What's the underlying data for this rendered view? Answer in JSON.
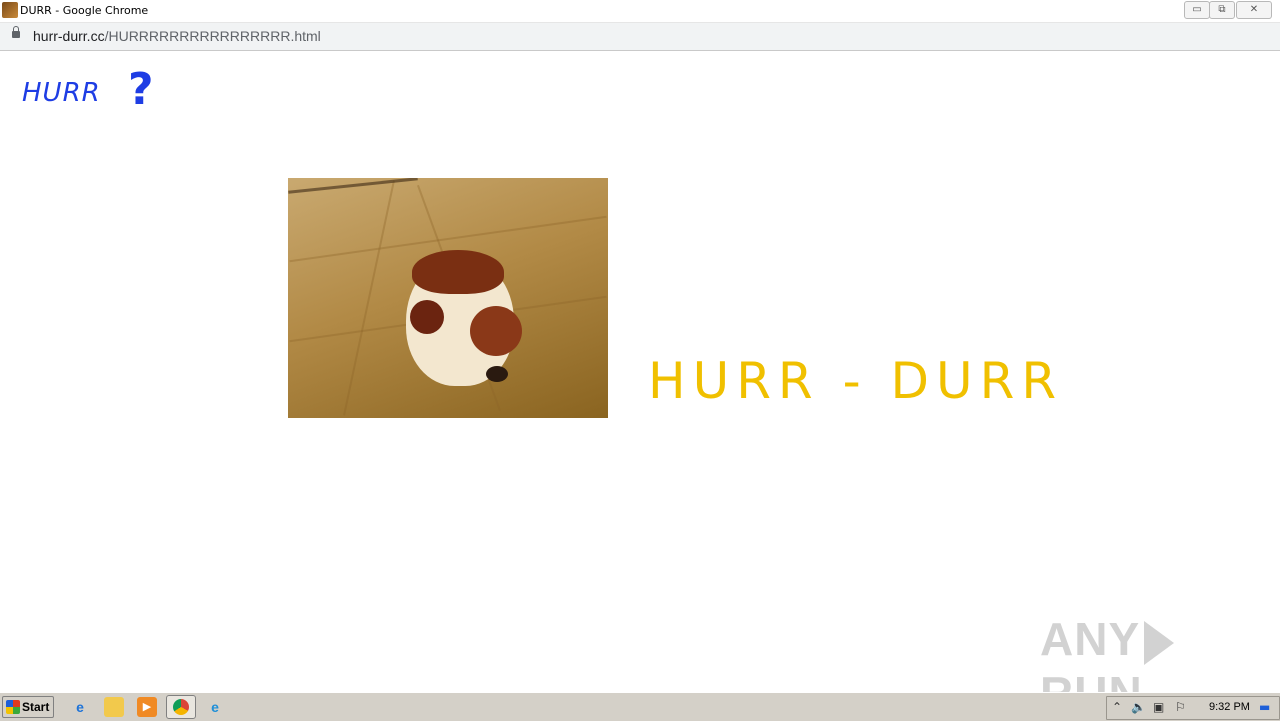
{
  "window": {
    "title": "DURR - Google Chrome",
    "controls": {
      "minimize": "▭",
      "restore": "⧉",
      "close": "✕"
    }
  },
  "address_bar": {
    "host": "hurr-durr.cc",
    "path": "/HURRRRRRRRRRRRRRRR.html"
  },
  "page": {
    "logo_text": "HURR",
    "logo_mark": "?",
    "headline": "HURR - DURR",
    "colors": {
      "logo": "#1e3de4",
      "headline": "#f0c000"
    }
  },
  "watermark": {
    "left": "ANY",
    "right": "RUN"
  },
  "taskbar": {
    "start_label": "Start",
    "apps": [
      "ie-icon",
      "explorer-icon",
      "media-player-icon",
      "chrome-icon",
      "edge-icon"
    ],
    "clock": "9:32 PM"
  }
}
